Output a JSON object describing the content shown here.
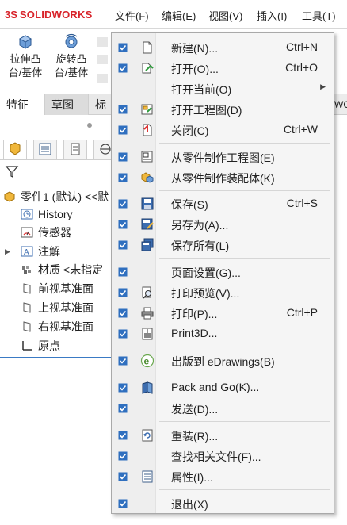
{
  "app": {
    "logo_mark": "3S",
    "logo_text": "SOLIDWORKS"
  },
  "top_menu": [
    "文件(F)",
    "编辑(E)",
    "视图(V)",
    "插入(I)",
    "工具(T)"
  ],
  "ribbon": [
    {
      "label": "拉伸凸\n台/基体",
      "line1": "拉伸凸",
      "line2": "台/基体"
    },
    {
      "label": "旋转凸\n台/基体",
      "line1": "旋转凸",
      "line2": "台/基体"
    }
  ],
  "tabs": [
    "特征",
    "草图",
    "标"
  ],
  "right_fragment": "WO",
  "tree": [
    {
      "label": "零件1 (默认) <<默",
      "icon": "part-icon"
    },
    {
      "label": "History",
      "icon": "history-icon"
    },
    {
      "label": "传感器",
      "icon": "sensor-icon"
    },
    {
      "label": "注解",
      "icon": "annotation-icon"
    },
    {
      "label": "材质 <未指定",
      "icon": "material-icon"
    },
    {
      "label": "前视基准面",
      "icon": "plane-icon"
    },
    {
      "label": "上视基准面",
      "icon": "plane-icon"
    },
    {
      "label": "右视基准面",
      "icon": "plane-icon"
    },
    {
      "label": "原点",
      "icon": "origin-icon"
    }
  ],
  "menu": [
    {
      "label": "新建(N)...",
      "shortcut": "Ctrl+N",
      "icon": "new-document-icon"
    },
    {
      "label": "打开(O)...",
      "shortcut": "Ctrl+O",
      "icon": "open-icon"
    },
    {
      "label": "打开当前(O)",
      "shortcut": "",
      "icon": "",
      "submenu": true
    },
    {
      "label": "打开工程图(D)",
      "shortcut": "",
      "icon": "open-drawing-icon"
    },
    {
      "label": "关闭(C)",
      "shortcut": "Ctrl+W",
      "icon": "close-document-icon"
    },
    {
      "label": "从零件制作工程图(E)",
      "shortcut": "",
      "icon": "make-drawing-icon"
    },
    {
      "label": "从零件制作装配体(K)",
      "shortcut": "",
      "icon": "make-assembly-icon"
    },
    {
      "label": "保存(S)",
      "shortcut": "Ctrl+S",
      "icon": "save-icon"
    },
    {
      "label": "另存为(A)...",
      "shortcut": "",
      "icon": "save-as-icon"
    },
    {
      "label": "保存所有(L)",
      "shortcut": "",
      "icon": "save-all-icon"
    },
    {
      "label": "页面设置(G)...",
      "shortcut": "",
      "icon": ""
    },
    {
      "label": "打印预览(V)...",
      "shortcut": "",
      "icon": "print-preview-icon"
    },
    {
      "label": "打印(P)...",
      "shortcut": "Ctrl+P",
      "icon": "print-icon"
    },
    {
      "label": "Print3D...",
      "shortcut": "",
      "icon": "print3d-icon"
    },
    {
      "label": "出版到 eDrawings(B)",
      "shortcut": "",
      "icon": "edrawings-icon"
    },
    {
      "label": "Pack and Go(K)...",
      "shortcut": "",
      "icon": "pack-and-go-icon"
    },
    {
      "label": "发送(D)...",
      "shortcut": "",
      "icon": ""
    },
    {
      "label": "重装(R)...",
      "shortcut": "",
      "icon": "reload-icon"
    },
    {
      "label": "查找相关文件(F)...",
      "shortcut": "",
      "icon": ""
    },
    {
      "label": "属性(I)...",
      "shortcut": "",
      "icon": "properties-icon"
    },
    {
      "label": "退出(X)",
      "shortcut": "",
      "icon": ""
    }
  ],
  "colors": {
    "brand": "#d8232a",
    "check": "#2f6fbf",
    "selection_line": "#3a7ac4"
  }
}
